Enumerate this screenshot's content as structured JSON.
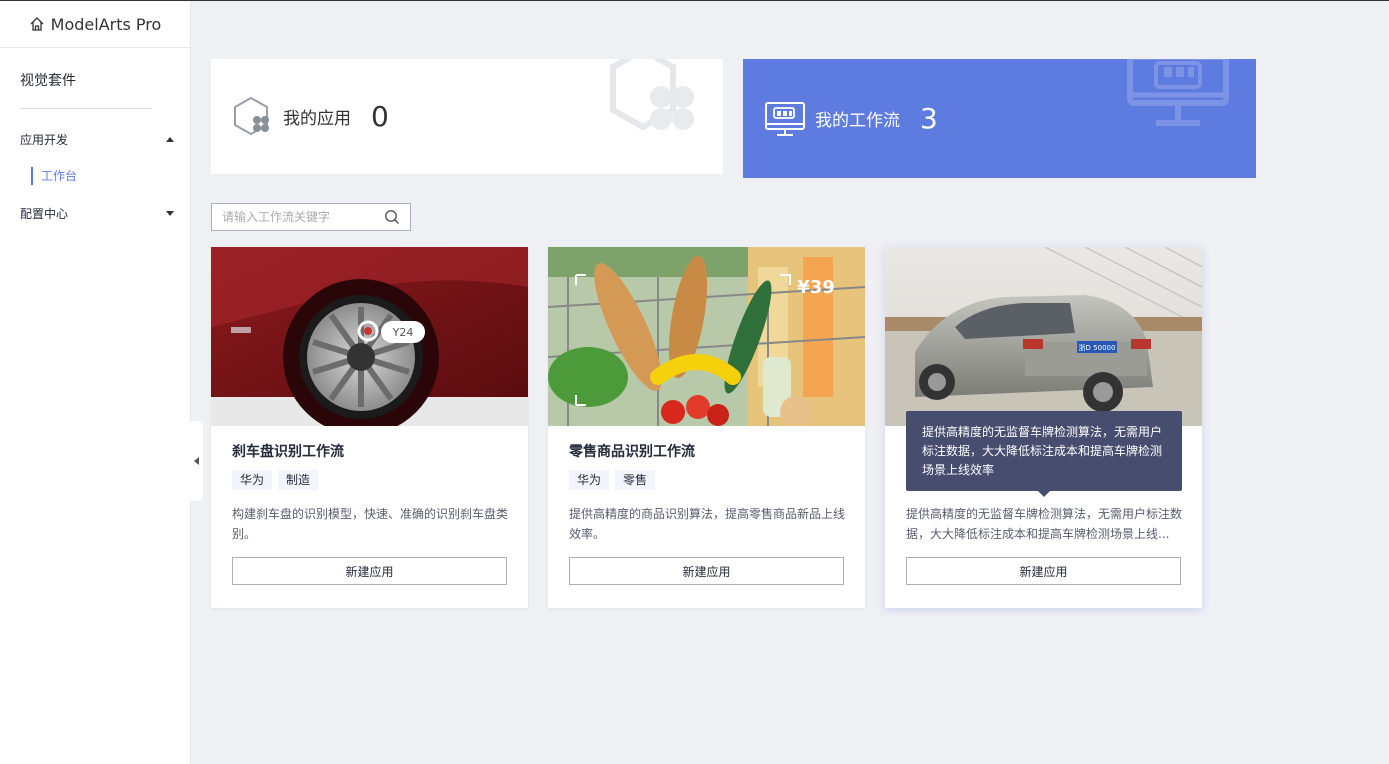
{
  "app": {
    "title": "ModelArts Pro",
    "home_icon": "home-icon"
  },
  "sidebar": {
    "suite": "视觉套件",
    "groups": [
      {
        "label": "应用开发",
        "expanded": true,
        "items": [
          {
            "label": "工作台",
            "active": true
          }
        ]
      },
      {
        "label": "配置中心",
        "expanded": false,
        "items": []
      }
    ]
  },
  "stats": {
    "apps": {
      "label": "我的应用",
      "count": "0",
      "icon": "app-hexagon-icon"
    },
    "flows": {
      "label": "我的工作流",
      "count": "3",
      "icon": "workflow-monitor-icon"
    }
  },
  "search": {
    "placeholder": "请输入工作流关键字",
    "value": "",
    "icon": "search-icon"
  },
  "workflows": [
    {
      "title": "刹车盘识别工作流",
      "tags": [
        "华为",
        "制造"
      ],
      "description": "构建刹车盘的识别模型，快速、准确的识别刹车盘类别。",
      "button": "新建应用",
      "image_label": "Y24"
    },
    {
      "title": "零售商品识别工作流",
      "tags": [
        "华为",
        "零售"
      ],
      "description": "提供高精度的商品识别算法，提高零售商品新品上线效率。",
      "button": "新建应用",
      "image_label": "¥39"
    },
    {
      "title": "",
      "tags": [],
      "description": "提供高精度的无监督车牌检测算法，无需用户标注数据，大大降低标注成本和提高车牌检测场景上线...",
      "button": "新建应用",
      "image_label": "浙D 50000"
    }
  ],
  "tooltip": {
    "text": "提供高精度的无监督车牌检测算法，无需用户标注数据，大大降低标注成本和提高车牌检测场景上线效率"
  },
  "colors": {
    "accent": "#5e7ce0",
    "background": "#eff0f4",
    "tooltip": "#464d6e"
  }
}
